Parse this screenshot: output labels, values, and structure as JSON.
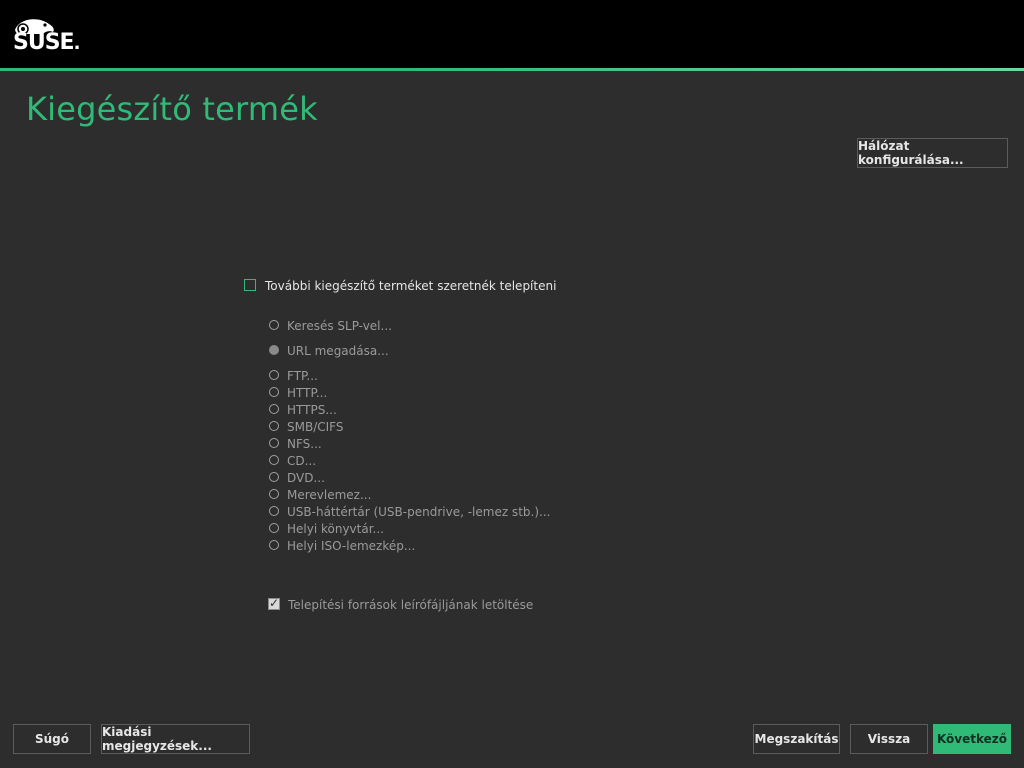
{
  "header": {
    "logo_text": "SUSE"
  },
  "page": {
    "title": "Kiegészítő termék"
  },
  "network_button": "Hálózat konfigurálása...",
  "main_checkbox": {
    "label": "További kiegészítő terméket szeretnék telepíteni",
    "checked": false
  },
  "options": [
    {
      "label": "Keresés SLP-vel...",
      "selected": false
    },
    {
      "label": "URL megadása...",
      "selected": true
    },
    {
      "label": "FTP...",
      "selected": false
    },
    {
      "label": "HTTP...",
      "selected": false
    },
    {
      "label": "HTTPS...",
      "selected": false
    },
    {
      "label": "SMB/CIFS",
      "selected": false
    },
    {
      "label": "NFS...",
      "selected": false
    },
    {
      "label": "CD...",
      "selected": false
    },
    {
      "label": "DVD...",
      "selected": false
    },
    {
      "label": "Merevlemez...",
      "selected": false
    },
    {
      "label": "USB-háttértár (USB-pendrive, -lemez stb.)...",
      "selected": false
    },
    {
      "label": "Helyi könyvtár...",
      "selected": false
    },
    {
      "label": "Helyi ISO-lemezkép...",
      "selected": false
    }
  ],
  "download_checkbox": {
    "label": "Telepítési források leírófájljának letöltése",
    "checked": true
  },
  "footer": {
    "help": "Súgó",
    "release_notes": "Kiadási megjegyzések...",
    "abort": "Megszakítás",
    "back": "Vissza",
    "next": "Következő"
  },
  "colors": {
    "accent": "#30ba78",
    "background": "#2d2d2d",
    "header": "#000000"
  }
}
